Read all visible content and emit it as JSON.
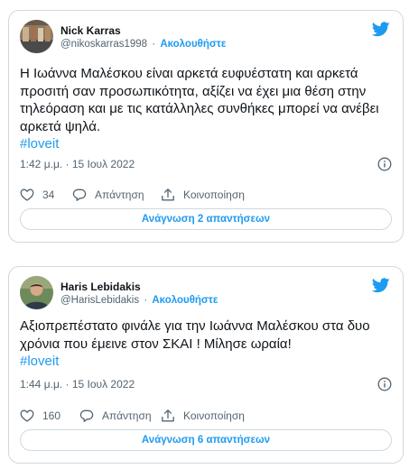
{
  "tweets": [
    {
      "author_name": "Nick Karras",
      "handle": "@nikoskarras1998",
      "separator": "·",
      "follow_label": "Ακολουθήστε",
      "text": "Η Ιωάννα Μαλέσκου είναι αρκετά ευφυέστατη και αρκετά προσιτή σαν προσωπικότητα, αξίζει να έχει μια θέση στην τηλεόραση και με τις κατάλληλες συνθήκες μπορεί να ανέβει αρκετά ψηλά.",
      "hashtag": "#loveit",
      "timestamp": "1:42 μ.μ. · 15 Ιουλ 2022",
      "likes": "34",
      "reply_label": "Απάντηση",
      "share_label": "Κοινοποίηση",
      "read_replies_label": "Ανάγνωση 2 απαντήσεων"
    },
    {
      "author_name": "Haris Lebidakis",
      "handle": "@HarisLebidakis",
      "separator": "·",
      "follow_label": "Ακολουθήστε",
      "text": "Αξιοπρεπέστατο φινάλε για την Ιωάννα Μαλέσκου στα δυο χρόνια που έμεινε στον ΣΚΑΙ ! Μίλησε ωραία!",
      "hashtag": "#loveit",
      "timestamp": "1:44 μ.μ. · 15 Ιουλ 2022",
      "likes": "160",
      "reply_label": "Απάντηση",
      "share_label": "Κοινοποίηση",
      "read_replies_label": "Ανάγνωση 6 απαντήσεων"
    }
  ],
  "icons": {
    "brand": "twitter-bird-icon",
    "info": "info-circle-icon",
    "like": "heart-icon",
    "reply": "speech-bubble-icon",
    "share": "share-upload-icon"
  },
  "colors": {
    "accent": "#1d9bf0",
    "text": "#0f1419",
    "secondary_text": "#536471",
    "border": "#cfd9de"
  }
}
